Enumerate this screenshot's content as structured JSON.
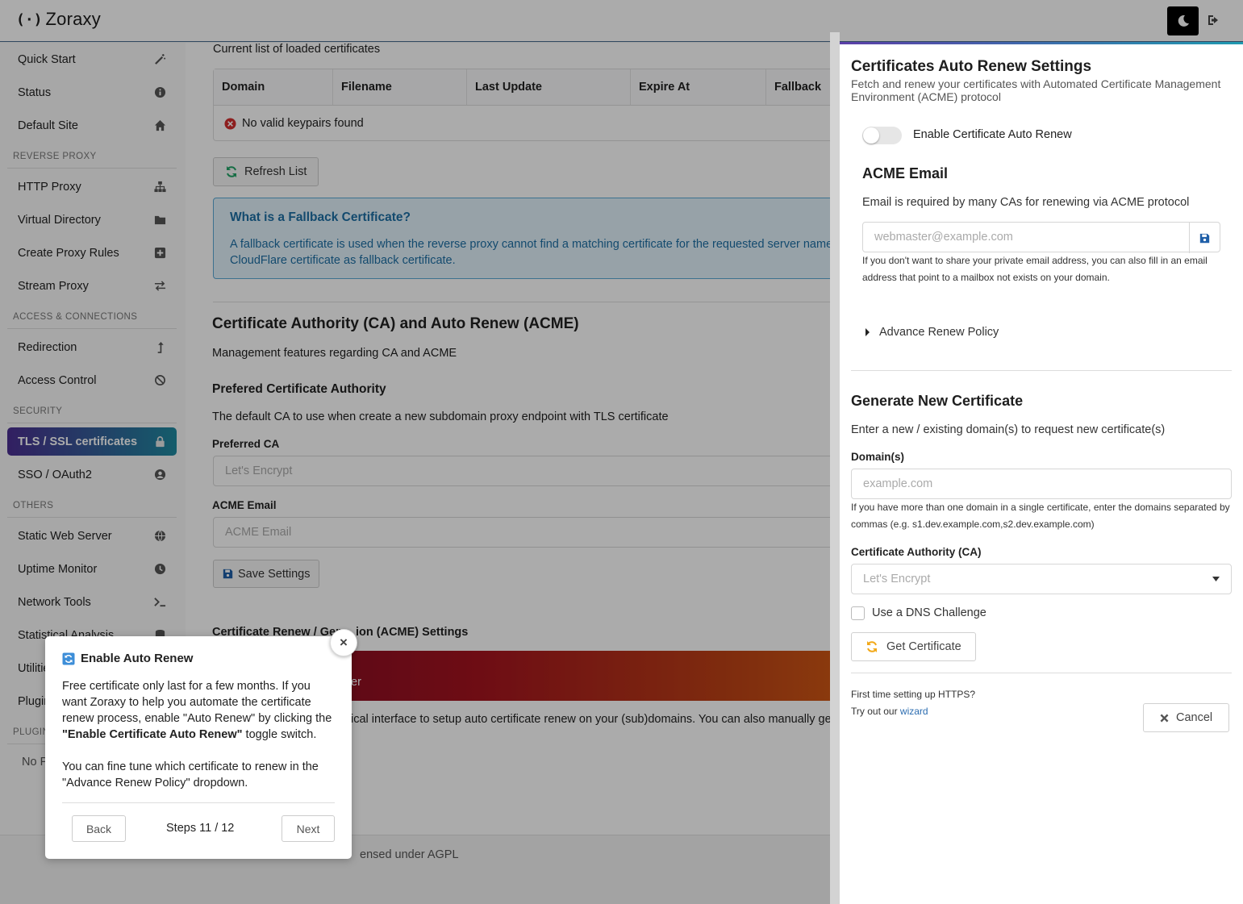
{
  "app": {
    "logo_mark": "(·)",
    "name": "Zoraxy"
  },
  "sidebar": {
    "items": [
      {
        "label": "Quick Start",
        "icon": "wand-icon"
      },
      {
        "label": "Status",
        "icon": "info-icon"
      },
      {
        "label": "Default Site",
        "icon": "home-icon"
      },
      {
        "label": "HTTP Proxy",
        "icon": "sitemap-icon"
      },
      {
        "label": "Virtual Directory",
        "icon": "folder-icon"
      },
      {
        "label": "Create Proxy Rules",
        "icon": "plus-square-icon"
      },
      {
        "label": "Stream Proxy",
        "icon": "exchange-icon"
      },
      {
        "label": "Redirection",
        "icon": "level-up-icon"
      },
      {
        "label": "Access Control",
        "icon": "ban-icon"
      },
      {
        "label": "TLS / SSL certificates",
        "icon": "lock-icon"
      },
      {
        "label": "SSO / OAuth2",
        "icon": "user-circle-icon"
      },
      {
        "label": "Static Web Server",
        "icon": "globe-icon"
      },
      {
        "label": "Uptime Monitor",
        "icon": "clock-icon"
      },
      {
        "label": "Network Tools",
        "icon": "terminal-icon"
      },
      {
        "label": "Statistical Analysis",
        "icon": "database-icon"
      },
      {
        "label": "Utilities",
        "icon": ""
      },
      {
        "label": "Plugins",
        "icon": ""
      }
    ],
    "sections": [
      "REVERSE PROXY",
      "ACCESS & CONNECTIONS",
      "SECURITY",
      "OTHERS",
      "PLUGINS"
    ],
    "no_plugins": "No P"
  },
  "main": {
    "cert_list_caption": "Current list of loaded certificates",
    "table_headers": [
      "Domain",
      "Filename",
      "Last Update",
      "Expire At",
      "Fallback"
    ],
    "table_empty": "No valid keypairs found",
    "refresh_label": "Refresh List",
    "fallback_title": "What is a Fallback Certificate?",
    "fallback_text_1": "A fallback certificate is used when the reverse proxy cannot find a matching certificate for the requested server name. If you a",
    "fallback_text_2": "CloudFlare certificate as fallback certificate.",
    "ca_heading": "Certificate Authority (CA) and Auto Renew (ACME)",
    "ca_desc": "Management features regarding CA and ACME",
    "pref_ca_heading": "Prefered Certificate Authority",
    "pref_ca_desc": "The default CA to use when create a new subdomain proxy endpoint with TLS certificate",
    "preferred_ca_label": "Preferred CA",
    "preferred_ca_value": "Let's Encrypt",
    "acme_email_label": "ACME Email",
    "acme_email_placeholder": "ACME Email",
    "save_label": "Save Settings",
    "renew_heading_a": "Certificate Renew / Gen",
    "renew_heading_b": "ion (ACME) Settings",
    "banner_tail": "er",
    "renew_desc": "ical interface to setup auto certificate renew on your (sub)domains. You can also manually generate a",
    "footer_text": "ensed under AGPL"
  },
  "panel": {
    "title": "Certificates Auto Renew Settings",
    "subtitle": "Fetch and renew your certificates with Automated Certificate Management Environment (ACME) protocol",
    "toggle_label": "Enable Certificate Auto Renew",
    "toggle_on": false,
    "acme_heading": "ACME Email",
    "acme_desc": "Email is required by many CAs for renewing via ACME protocol",
    "acme_placeholder": "webmaster@example.com",
    "acme_note": "If you don't want to share your private email address, you can also fill in an email address that point to a mailbox not exists on your domain.",
    "advance_policy": "Advance Renew Policy",
    "gen_heading": "Generate New Certificate",
    "gen_desc": "Enter a new / existing domain(s) to request new certificate(s)",
    "domains_label": "Domain(s)",
    "domains_placeholder": "example.com",
    "domains_note": "If you have more than one domain in a single certificate, enter the domains separated by commas (e.g. s1.dev.example.com,s2.dev.example.com)",
    "ca_label": "Certificate Authority (CA)",
    "ca_value": "Let's Encrypt",
    "dns_label": "Use a DNS Challenge",
    "get_cert_label": "Get Certificate",
    "first_time": "First time setting up HTTPS?",
    "try_out": "Try out our",
    "wizard": "wizard",
    "cancel_label": "Cancel"
  },
  "tour": {
    "title": "Enable Auto Renew",
    "p1_a": "Free certificate only last for a few months. If you want Zoraxy to help you automate the certificate renew process, enable \"Auto Renew\" by clicking the ",
    "p1_b": "\"Enable Certificate Auto Renew\"",
    "p1_c": " toggle switch.",
    "p2": "You can fine tune which certificate to renew in the \"Advance Renew Policy\" dropdown.",
    "back_label": "Back",
    "steps": "Steps 11 / 12",
    "next_label": "Next",
    "close_glyph": "×"
  },
  "colors": {
    "accent_start": "#4b2f91",
    "accent_end": "#1f8aa0",
    "link": "#2b6cb0"
  }
}
